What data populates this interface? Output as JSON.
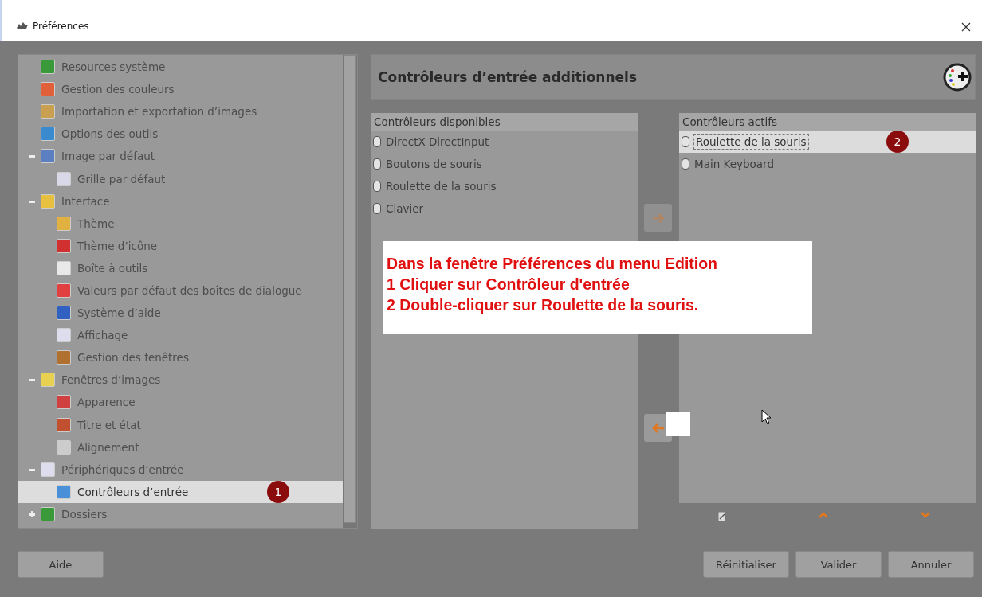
{
  "window": {
    "title": "Préférences"
  },
  "tree": {
    "items": [
      {
        "label": "Resources système",
        "selected": false
      },
      {
        "label": "Gestion des couleurs",
        "selected": false
      },
      {
        "label": "Importation et exportation d’images",
        "selected": false
      },
      {
        "label": "Options des outils",
        "selected": false
      },
      {
        "label": "Image par défaut",
        "selected": false,
        "expanded": true,
        "children": [
          {
            "label": "Grille par défaut",
            "selected": false
          }
        ]
      },
      {
        "label": "Interface",
        "selected": false,
        "expanded": true,
        "children": [
          {
            "label": "Thème",
            "selected": false
          },
          {
            "label": "Thème d’icône",
            "selected": false
          },
          {
            "label": "Boîte à outils",
            "selected": false
          },
          {
            "label": "Valeurs par défaut des boîtes de dialogue",
            "selected": false
          },
          {
            "label": "Système d’aide",
            "selected": false
          },
          {
            "label": "Affichage",
            "selected": false
          },
          {
            "label": "Gestion des fenêtres",
            "selected": false
          }
        ]
      },
      {
        "label": "Fenêtres d’images",
        "selected": false,
        "expanded": true,
        "children": [
          {
            "label": "Apparence",
            "selected": false
          },
          {
            "label": "Titre et état",
            "selected": false
          },
          {
            "label": "Alignement",
            "selected": false
          }
        ]
      },
      {
        "label": "Périphériques d’entrée",
        "selected": false,
        "expanded": true,
        "children": [
          {
            "label": "Contrôleurs d’entrée",
            "selected": true,
            "badge": "1"
          }
        ]
      },
      {
        "label": "Dossiers",
        "selected": false,
        "expanded": false
      }
    ]
  },
  "page": {
    "title": "Contrôleurs d’entrée additionnels"
  },
  "available": {
    "header": "Contrôleurs disponibles",
    "items": [
      {
        "label": "DirectX DirectInput"
      },
      {
        "label": "Boutons de souris"
      },
      {
        "label": "Roulette de la souris"
      },
      {
        "label": "Clavier"
      }
    ]
  },
  "transfer_buttons": [
    {
      "kind": "add",
      "disabled": true
    },
    {
      "kind": "remove",
      "disabled": false
    }
  ],
  "active": {
    "header": "Contrôleurs actifs",
    "items": [
      {
        "label": "Roulette de la souris",
        "selected": true,
        "badge": "2"
      },
      {
        "label": "Main Keyboard",
        "selected": false
      }
    ]
  },
  "annotation": {
    "lines": [
      "Dans la fenêtre Préférences du menu Edition",
      "1 Cliquer sur Contrôleur d'entrée",
      "2 Double-cliquer sur Roulette de la souris."
    ]
  },
  "buttons": {
    "help": "Aide",
    "actions": [
      "Réinitialiser",
      "Valider",
      "Annuler"
    ]
  }
}
